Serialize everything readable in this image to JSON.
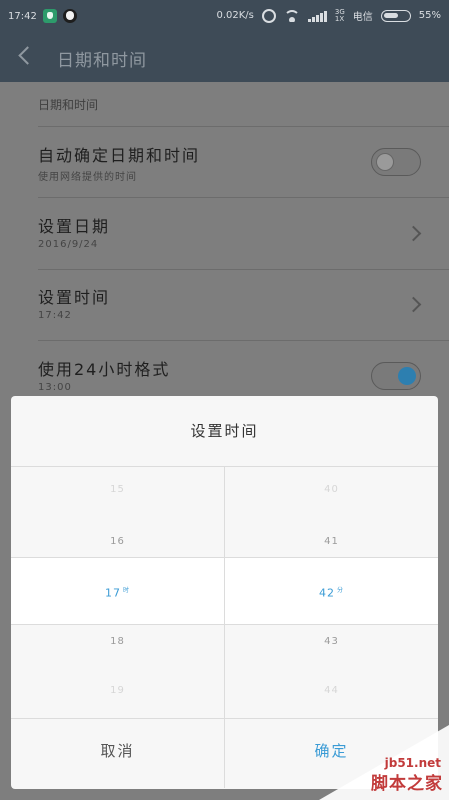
{
  "status_bar": {
    "time": "17:42",
    "speed": "0.02K/s",
    "network_type_top": "3G",
    "network_type_bottom": "1X",
    "carrier": "电信",
    "battery": "55%"
  },
  "header": {
    "title": "日期和时间"
  },
  "settings": {
    "section_title": "日期和时间",
    "auto_datetime": {
      "title": "自动确定日期和时间",
      "subtitle": "使用网络提供的时间",
      "enabled": false
    },
    "set_date": {
      "title": "设置日期",
      "value": "2016/9/24"
    },
    "set_time": {
      "title": "设置时间",
      "value": "17:42"
    },
    "use_24h": {
      "title": "使用24小时格式",
      "subtitle": "13:00",
      "enabled": true
    }
  },
  "dialog": {
    "title": "设置时间",
    "hours": {
      "far_above": "15",
      "above": "16",
      "selected": "17",
      "unit": "时",
      "below": "18",
      "far_below": "19"
    },
    "minutes": {
      "far_above": "40",
      "above": "41",
      "selected": "42",
      "unit": "分",
      "below": "43",
      "far_below": "44"
    },
    "cancel_label": "取消",
    "ok_label": "确定"
  },
  "watermark": {
    "site": "jb51.net",
    "brand": "脚本之家"
  },
  "colors": {
    "header_bg": "#3e4b57",
    "accent": "#3a9bd5",
    "overlay": "#7e7e7e",
    "dialog_bg": "#f7f7f7"
  }
}
